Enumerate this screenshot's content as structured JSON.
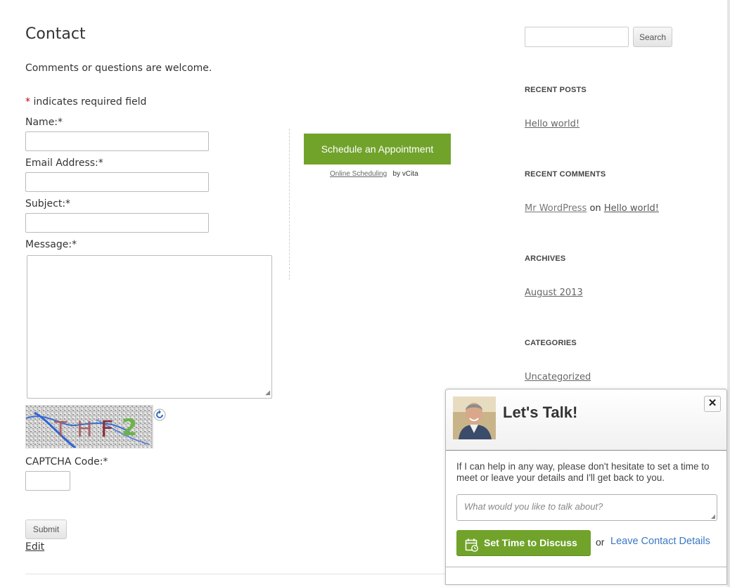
{
  "page": {
    "title": "Contact",
    "intro": "Comments or questions are welcome.",
    "required_star": "*",
    "required_note": " indicates required field"
  },
  "form": {
    "name_label": "Name:*",
    "email_label": "Email Address:*",
    "subject_label": "Subject:*",
    "message_label": "Message:*",
    "captcha_label": "CAPTCHA Code:*",
    "captcha_text": "THF2",
    "submit_label": "Submit"
  },
  "edit_link": "Edit",
  "scheduling": {
    "button_label": "Schedule an Appointment",
    "credit_link": "Online Scheduling",
    "credit_by": "by vCita",
    "button_color": "#71a32b"
  },
  "sidebar": {
    "search_button": "Search",
    "recent_posts_title": "RECENT POSTS",
    "recent_posts": [
      "Hello world!"
    ],
    "recent_comments_title": "RECENT COMMENTS",
    "recent_comment": {
      "author": "Mr WordPress",
      "on": "on",
      "post": "Hello world!"
    },
    "archives_title": "ARCHIVES",
    "archives": [
      "August 2013"
    ],
    "categories_title": "CATEGORIES",
    "categories": [
      "Uncategorized"
    ]
  },
  "lets_talk": {
    "title": "Let's Talk!",
    "close": "✕",
    "body": "If I can help in any way, please don't hesitate to set a time to meet or leave your details and I'll get back to you.",
    "placeholder": "What would you like to talk about?",
    "primary_button": "Set Time to Discuss",
    "or_text": "or",
    "leave_link": "Leave Contact Details",
    "link_color": "#3a78c3"
  },
  "icons": {
    "refresh": "refresh-icon",
    "calendar": "calendar-icon",
    "close": "close-icon"
  }
}
